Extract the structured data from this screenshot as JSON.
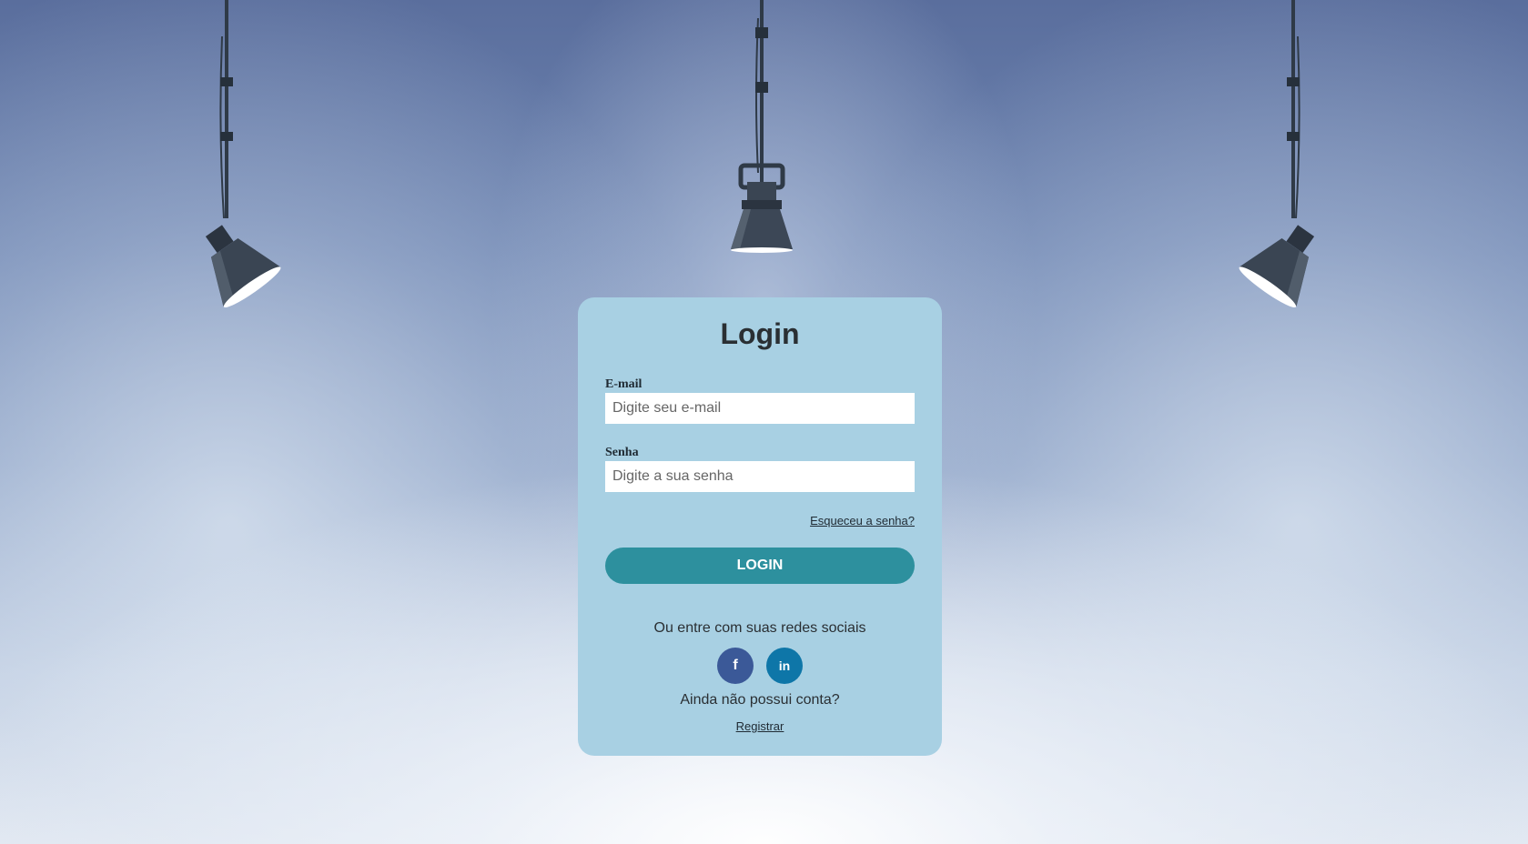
{
  "login": {
    "title": "Login",
    "email_label": "E-mail",
    "email_placeholder": "Digite seu e-mail",
    "password_label": "Senha",
    "password_placeholder": "Digite a sua senha",
    "forgot_link": "Esqueceu a senha?",
    "login_button": "LOGIN",
    "social_text": "Ou entre com suas redes sociais",
    "social": [
      {
        "name": "facebook",
        "icon": "facebook-icon",
        "glyph": "f",
        "color": "#3b5998"
      },
      {
        "name": "linkedin",
        "icon": "linkedin-icon",
        "glyph": "in",
        "color": "#0e76a8"
      }
    ],
    "no_account_text": "Ainda não possui conta?",
    "register_link": "Registrar"
  },
  "colors": {
    "card_background": "#a8d0e3",
    "button_background": "#2d909e",
    "lamp": "#2f3a47"
  }
}
